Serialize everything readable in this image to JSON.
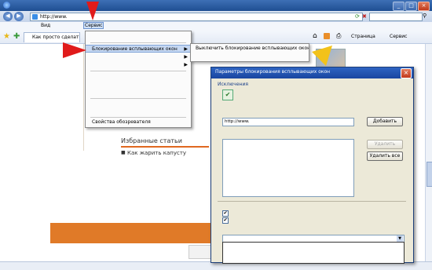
{
  "window": {
    "title": "",
    "buttons": [
      "_",
      "□",
      "×"
    ]
  },
  "address_bar": {
    "back": "◀",
    "forward": "▶",
    "url": "http://www.",
    "search_placeholder": ""
  },
  "menubar": {
    "items": [
      {
        "label": "",
        "active": false
      },
      {
        "label": "",
        "active": false
      },
      {
        "label": "Вид",
        "active": false
      },
      {
        "label": "",
        "active": false
      },
      {
        "label": "Сервис",
        "active": true
      },
      {
        "label": "",
        "active": false
      }
    ]
  },
  "favorites_bar": {
    "tab_label": "Как просто сделать",
    "page_menu": "Страница",
    "tools_menu": "Сервис"
  },
  "tools_menu": {
    "items": [
      {
        "label": "",
        "type": "item"
      },
      {
        "type": "sep"
      },
      {
        "label": "Блокирование всплывающих окон",
        "type": "item",
        "highlight": true,
        "submenu": true
      },
      {
        "label": "",
        "type": "item",
        "submenu": true
      },
      {
        "label": "",
        "type": "item",
        "submenu": true
      },
      {
        "type": "sep"
      },
      {
        "label": "",
        "type": "item",
        "disabled": true
      },
      {
        "label": "",
        "type": "item",
        "disabled": true
      },
      {
        "label": "",
        "type": "item"
      },
      {
        "type": "sep"
      },
      {
        "label": "",
        "type": "item"
      },
      {
        "label": "",
        "type": "item"
      },
      {
        "type": "sep"
      },
      {
        "label": "Свойства обозревателя",
        "type": "item"
      }
    ]
  },
  "submenu": {
    "items": [
      {
        "label": "Выключить блокирование всплывающих окон"
      },
      {
        "label": ""
      }
    ]
  },
  "page": {
    "sidebar_links": [
      ""
    ],
    "article_heading": "Избранные статьи",
    "article_link": "Как жарить капусту",
    "article_sub": ""
  },
  "dialog": {
    "title": "Параметры блокирования всплывающих окон",
    "section_exceptions": "Исключения",
    "exceptions_text": "",
    "address_label": "",
    "address_value": "http://www.",
    "add_button": "Добавить",
    "allowed_label": "",
    "allowed_items": [
      ""
    ],
    "remove_button": "Удалить",
    "remove_all_button": "Удалить все",
    "section_notify": "",
    "option1": "",
    "option2": "",
    "level_label": "",
    "level_value": "",
    "level_options": [
      "",
      "",
      ""
    ]
  },
  "status_bar": {
    "left": "",
    "zone": ""
  }
}
